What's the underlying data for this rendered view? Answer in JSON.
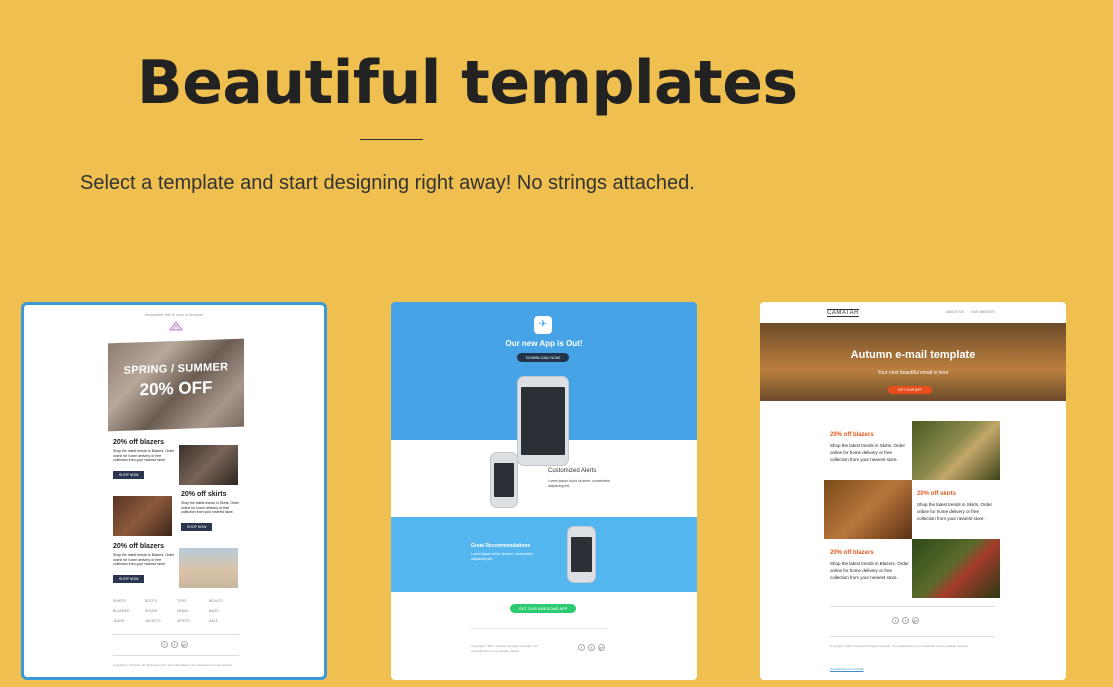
{
  "hero": {
    "title": "Beautiful templates",
    "subtitle": "Select a template and start designing right away! No strings attached."
  },
  "templates": [
    {
      "selected": true,
      "preheader": "Newsletter title & view in browser",
      "hero_line1": "SPRING / SUMMER",
      "hero_line2": "20% OFF",
      "blocks": [
        {
          "title": "20% off blazers",
          "text": "Shop the latest trends in Blazers. Order online for home delivery or free collection from your nearest store.",
          "button": "SHOP NOW"
        },
        {
          "title": "20% off skirts",
          "text": "Shop the latest trends in Skirts. Order online for home delivery or free collection from your nearest store.",
          "button": "SHOP NOW"
        },
        {
          "title": "20% off blazers",
          "text": "Shop the latest trends in Blazers. Order online for home delivery or free collection from your nearest store.",
          "button": "SHOP NOW"
        }
      ],
      "links": [
        "SHIRTS",
        "BOOTS",
        "TOPS",
        "BEAUTY",
        "BLAZERS",
        "SHOES",
        "DENIM",
        "BAGS",
        "JEANS",
        "JACKETS",
        "SKIRTS",
        "SALE"
      ],
      "social": [
        "f",
        "t",
        "g+"
      ],
      "footer": "Copyright © Topcoat. All rights reserved. You subscribed to our newsletter via our website."
    },
    {
      "app_icon": "✈",
      "title": "Our new App is Out!",
      "download": "DOWNLOAD NOW",
      "alert_title": "Customized Alerts",
      "alert_text": "Lorem ipsum dolor sit amet, consectetur adipiscing elit.",
      "rec_title": "Great Recommendations",
      "rec_text": "Lorem ipsum dolor sit amet, consectetur adipiscing elit.",
      "cta": "GET OUR AWESOME APP",
      "footer": "Copyright © 2017 Topcoat. All rights reserved. You subscribed from our website, thanks.",
      "social": [
        "f",
        "t",
        "g+"
      ]
    },
    {
      "logo": "CAMATAR",
      "nav": [
        "ABOUT US",
        "OUR WEBSITE"
      ],
      "hero_title": "Autumn e-mail template",
      "hero_sub": "Your next beautiful email is here",
      "hero_btn": "GET OUR APP",
      "blocks": [
        {
          "title": "20% off blazers",
          "text": "Shop the latest trends in Skirts. Order online for home delivery or free collection from your nearest store."
        },
        {
          "title": "20% off skirts",
          "text": "Shop the latest trends in Skirts. Order online for home delivery or free collection from your nearest store."
        },
        {
          "title": "20% off blazers",
          "text": "Shop the latest trends in Blazers. Order online for home delivery or free collection from your nearest store."
        }
      ],
      "social": [
        "f",
        "t",
        "g+"
      ],
      "footer": "Copyright © 2017 Topcoat. All rights reserved. You subscribed to our newsletter via our website, topcoat.",
      "unsubscribe": "Unsubscribe from this list"
    }
  ],
  "colors": {
    "background": "#efbf4f",
    "selected_border": "#3a9ad9",
    "app_blue": "#45a3e6",
    "cta_green": "#2ecc71",
    "autumn_orange": "#e05a1e"
  }
}
